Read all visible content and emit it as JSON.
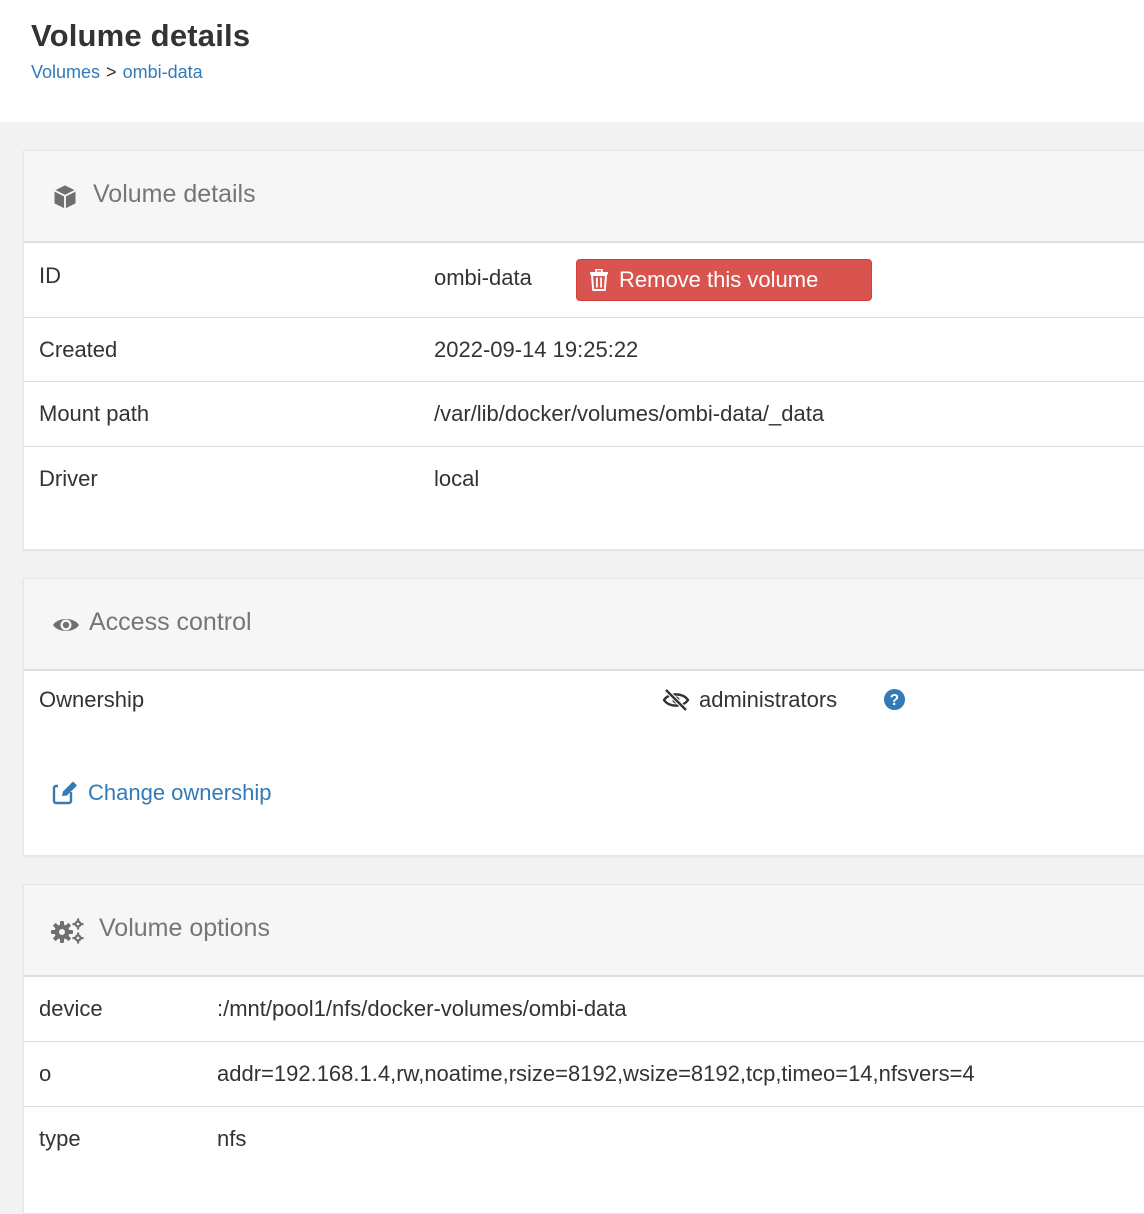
{
  "header": {
    "title": "Volume details",
    "breadcrumb": [
      {
        "label": "Volumes"
      },
      {
        "label": "ombi-data"
      }
    ],
    "separator": ">"
  },
  "volume_details": {
    "title": "Volume details",
    "icon": "cube-icon",
    "rows": [
      {
        "label": "ID",
        "value": "ombi-data"
      },
      {
        "label": "Created",
        "value": "2022-09-14 19:25:22"
      },
      {
        "label": "Mount path",
        "value": "/var/lib/docker/volumes/ombi-data/_data"
      },
      {
        "label": "Driver",
        "value": "local"
      }
    ],
    "remove_button": "Remove this volume"
  },
  "access_control": {
    "title": "Access control",
    "icon": "eye-icon",
    "ownership_label": "Ownership",
    "ownership_value": "administrators",
    "change_link": "Change ownership"
  },
  "volume_options": {
    "title": "Volume options",
    "icon": "gears-icon",
    "rows": [
      {
        "key": "device",
        "value": ":/mnt/pool1/nfs/docker-volumes/ombi-data"
      },
      {
        "key": "o",
        "value": "addr=192.168.1.4,rw,noatime,rsize=8192,wsize=8192,tcp,timeo=14,nfsvers=4"
      },
      {
        "key": "type",
        "value": "nfs"
      }
    ]
  },
  "colors": {
    "link": "#337ab7",
    "danger": "#d9534f",
    "header_bg": "#f6f6f6",
    "muted_title": "#767676"
  }
}
